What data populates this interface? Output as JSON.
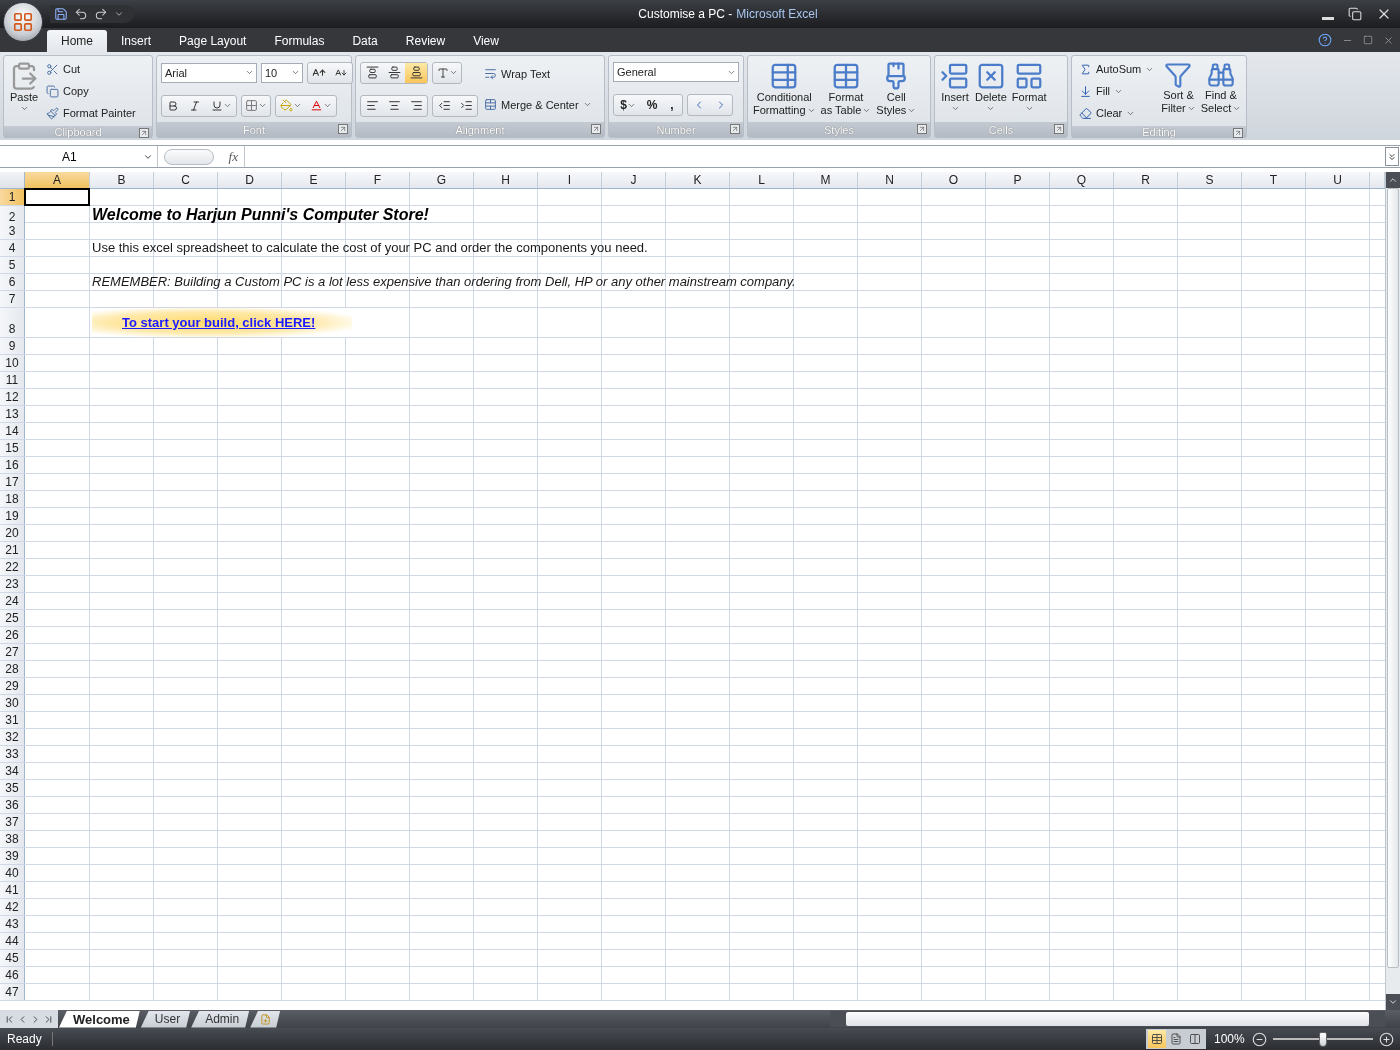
{
  "window": {
    "title": "Customise a PC",
    "separator": "-",
    "app": "Microsoft Excel"
  },
  "ribbon_tabs": [
    {
      "label": "Home",
      "selected": true
    },
    {
      "label": "Insert",
      "selected": false
    },
    {
      "label": "Page Layout",
      "selected": false
    },
    {
      "label": "Formulas",
      "selected": false
    },
    {
      "label": "Data",
      "selected": false
    },
    {
      "label": "Review",
      "selected": false
    },
    {
      "label": "View",
      "selected": false
    }
  ],
  "clipboard": {
    "label": "Clipboard",
    "paste": "Paste",
    "items": [
      "Cut",
      "Copy",
      "Format Painter"
    ]
  },
  "font": {
    "label": "Font",
    "font_name": "Arial",
    "font_size": "10"
  },
  "alignment": {
    "label": "Alignment",
    "wrap_text": "Wrap Text",
    "merge": "Merge & Center",
    "vertical_align": [
      {
        "selected": false
      },
      {
        "selected": false
      },
      {
        "selected": true
      }
    ]
  },
  "number": {
    "label": "Number",
    "format": "General",
    "symbols": [
      "$",
      "%",
      ","
    ]
  },
  "styles": {
    "label": "Styles",
    "buttons": [
      {
        "lines": [
          "Conditional",
          "Formatting"
        ]
      },
      {
        "lines": [
          "Format",
          "as Table"
        ]
      },
      {
        "lines": [
          "Cell",
          "Styles"
        ]
      }
    ]
  },
  "cells_group": {
    "label": "Cells",
    "buttons": [
      "Insert",
      "Delete",
      "Format"
    ]
  },
  "editing": {
    "label": "Editing",
    "small": [
      "AutoSum",
      "Fill",
      "Clear"
    ],
    "large": [
      {
        "lines": [
          "Sort &",
          "Filter"
        ]
      },
      {
        "lines": [
          "Find &",
          "Select"
        ]
      }
    ]
  },
  "formula_bar": {
    "name_box": "A1",
    "fx": "fx"
  },
  "columns": [
    {
      "label": "A",
      "selected": true
    },
    {
      "label": "B",
      "selected": false
    },
    {
      "label": "C",
      "selected": false
    },
    {
      "label": "D",
      "selected": false
    },
    {
      "label": "E",
      "selected": false
    },
    {
      "label": "F",
      "selected": false
    },
    {
      "label": "G",
      "selected": false
    },
    {
      "label": "H",
      "selected": false
    },
    {
      "label": "I",
      "selected": false
    },
    {
      "label": "J",
      "selected": false
    },
    {
      "label": "K",
      "selected": false
    },
    {
      "label": "L",
      "selected": false
    },
    {
      "label": "M",
      "selected": false
    },
    {
      "label": "N",
      "selected": false
    },
    {
      "label": "O",
      "selected": false
    },
    {
      "label": "P",
      "selected": false
    },
    {
      "label": "Q",
      "selected": false
    },
    {
      "label": "R",
      "selected": false
    },
    {
      "label": "S",
      "selected": false
    },
    {
      "label": "T",
      "selected": false
    },
    {
      "label": "U",
      "selected": false
    }
  ],
  "rows": [
    {
      "label": "1",
      "selected": true
    },
    {
      "label": "2",
      "selected": false,
      "kind": "heading",
      "text": "Welcome to Harjun Punni's Computer Store!"
    },
    {
      "label": "3",
      "selected": false
    },
    {
      "label": "4",
      "selected": false,
      "kind": "body",
      "text": "Use this excel spreadsheet to calculate the cost of your PC and order the components you need."
    },
    {
      "label": "5",
      "selected": false
    },
    {
      "label": "6",
      "selected": false,
      "kind": "italic",
      "text": "REMEMBER: Building a Custom PC is a lot less expensive than ordering from Dell, HP or any other mainstream company."
    },
    {
      "label": "7",
      "selected": false
    },
    {
      "label": "8",
      "selected": false,
      "kind": "link",
      "text": "To start your build, click HERE!"
    },
    {
      "label": "9",
      "selected": false
    },
    {
      "label": "10",
      "selected": false
    },
    {
      "label": "11",
      "selected": false
    },
    {
      "label": "12",
      "selected": false
    },
    {
      "label": "13",
      "selected": false
    },
    {
      "label": "14",
      "selected": false
    },
    {
      "label": "15",
      "selected": false
    },
    {
      "label": "16",
      "selected": false
    },
    {
      "label": "17",
      "selected": false
    },
    {
      "label": "18",
      "selected": false
    },
    {
      "label": "19",
      "selected": false
    },
    {
      "label": "20",
      "selected": false
    },
    {
      "label": "21",
      "selected": false
    },
    {
      "label": "22",
      "selected": false
    },
    {
      "label": "23",
      "selected": false
    },
    {
      "label": "24",
      "selected": false
    },
    {
      "label": "25",
      "selected": false
    },
    {
      "label": "26",
      "selected": false
    },
    {
      "label": "27",
      "selected": false
    },
    {
      "label": "28",
      "selected": false
    },
    {
      "label": "29",
      "selected": false
    },
    {
      "label": "30",
      "selected": false
    },
    {
      "label": "31",
      "selected": false
    },
    {
      "label": "32",
      "selected": false
    },
    {
      "label": "33",
      "selected": false
    },
    {
      "label": "34",
      "selected": false
    },
    {
      "label": "35",
      "selected": false
    },
    {
      "label": "36",
      "selected": false
    },
    {
      "label": "37",
      "selected": false
    },
    {
      "label": "38",
      "selected": false
    },
    {
      "label": "39",
      "selected": false
    },
    {
      "label": "40",
      "selected": false
    },
    {
      "label": "41",
      "selected": false
    },
    {
      "label": "42",
      "selected": false
    },
    {
      "label": "43",
      "selected": false
    },
    {
      "label": "44",
      "selected": false
    },
    {
      "label": "45",
      "selected": false
    },
    {
      "label": "46",
      "selected": false
    },
    {
      "label": "47",
      "selected": false
    }
  ],
  "sheet_tabs": [
    {
      "label": "Welcome",
      "selected": true
    },
    {
      "label": "User",
      "selected": false
    },
    {
      "label": "Admin",
      "selected": false
    }
  ],
  "status_bar": {
    "status": "Ready",
    "views": [
      {
        "selected": true
      },
      {
        "selected": false
      },
      {
        "selected": false
      }
    ],
    "zoom": "100%",
    "zoom_slider": {
      "level": 0.5
    }
  }
}
